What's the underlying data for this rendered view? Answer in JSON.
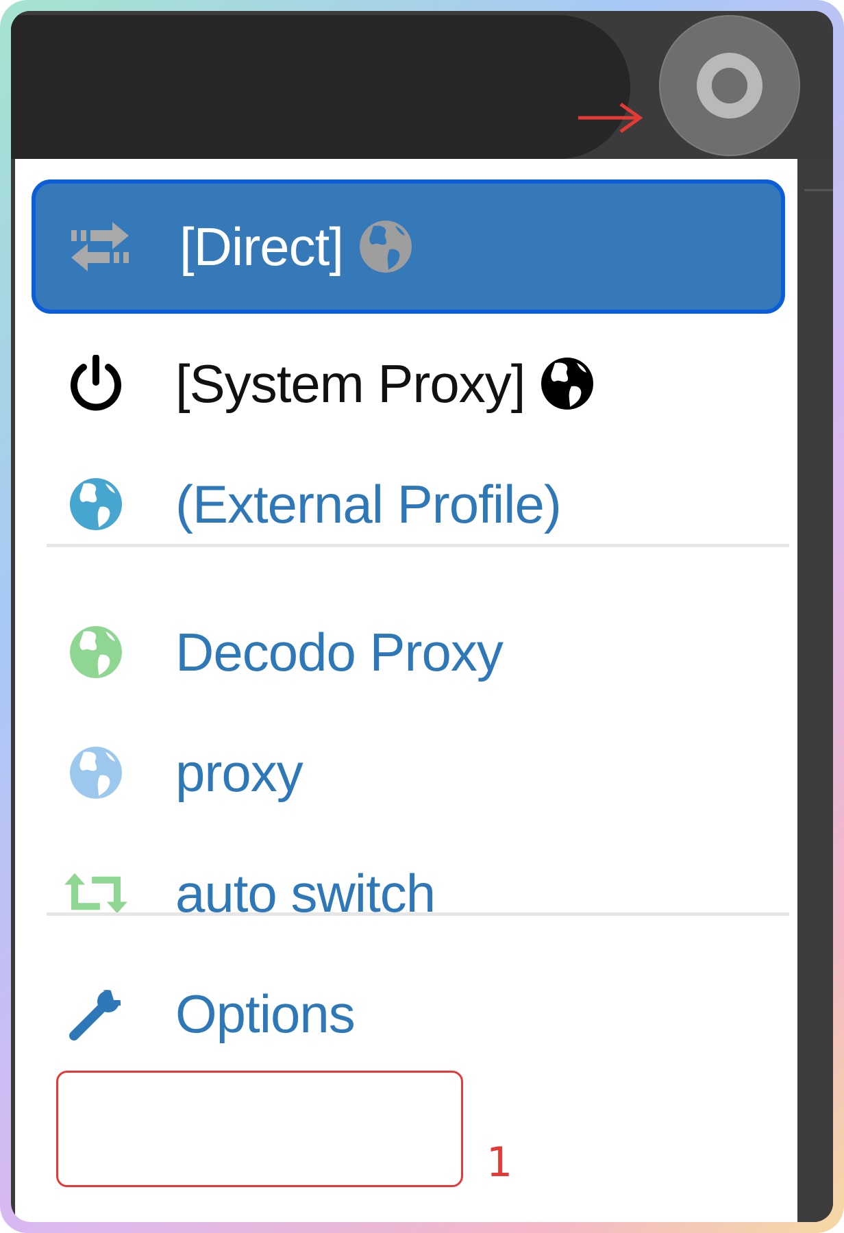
{
  "menu": {
    "items": [
      {
        "label": "[Direct]",
        "icon": "exchange-arrows-icon",
        "icon_color": "#a9a9a9",
        "trailing_icon": "globe-icon",
        "trailing_color": "#9e9e9e",
        "active": true
      },
      {
        "label": "[System Proxy]",
        "icon": "power-icon",
        "icon_color": "#000000",
        "trailing_icon": "globe-icon",
        "trailing_color": "#000000",
        "active": false
      },
      {
        "label": "(External Profile)",
        "icon": "globe-icon",
        "icon_color": "#46a6cf",
        "active": false
      },
      {
        "label": "Decodo Proxy",
        "icon": "globe-icon",
        "icon_color": "#8fd693",
        "active": false
      },
      {
        "label": "proxy",
        "icon": "globe-icon",
        "icon_color": "#9bc8ec",
        "active": false
      },
      {
        "label": "auto switch",
        "icon": "retweet-icon",
        "icon_color": "#8fd693",
        "active": false
      },
      {
        "label": "Options",
        "icon": "wrench-icon",
        "icon_color": "#2f78b8",
        "active": false
      }
    ]
  },
  "annotations": {
    "step_number": "1",
    "highlight_color": "#e53935"
  },
  "colors": {
    "active_bg": "#3579b8",
    "active_border": "#0b5ed7",
    "link_blue": "#2f78b8"
  }
}
